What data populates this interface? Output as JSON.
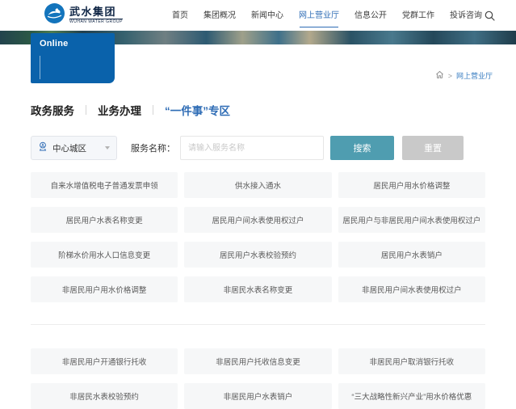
{
  "header": {
    "logo": {
      "name_cn": "武水集团",
      "name_en": "WUHAN WATER GROUP",
      "icon": "water-wave-logo"
    },
    "nav_items": [
      {
        "label": "首页",
        "active": false
      },
      {
        "label": "集团概况",
        "active": false
      },
      {
        "label": "新闻中心",
        "active": false
      },
      {
        "label": "网上营业厅",
        "active": true
      },
      {
        "label": "信息公开",
        "active": false
      },
      {
        "label": "党群工作",
        "active": false
      },
      {
        "label": "投诉咨询",
        "active": false
      }
    ],
    "search_icon": "magnifier"
  },
  "banner": {
    "overlay_label": "Online"
  },
  "breadcrumb": {
    "home_icon": "home",
    "separator": ">",
    "current": "网上营业厅"
  },
  "tabs": [
    {
      "label": "政务服务",
      "active": false
    },
    {
      "label": "业务办理",
      "active": false
    },
    {
      "label": "“一件事”专区",
      "active": true
    }
  ],
  "filter": {
    "district_icon": "location-person",
    "district_value": "中心城区",
    "service_label": "服务名称：",
    "input_placeholder": "请输入服务名称",
    "search_label": "搜索",
    "reset_label": "重置"
  },
  "services": {
    "group1": [
      "自来水增值税电子普通发票申领",
      "供水接入通水",
      "居民用户用水价格调整",
      "居民用户水表名称变更",
      "居民用户间水表使用权过户",
      "居民用户与非居民用户间水表使用权过户",
      "阶梯水价用水人口信息变更",
      "居民用户水表校验预约",
      "居民用户水表销户",
      "非居民用户用水价格调整",
      "非居民水表名称变更",
      "非居民用户间水表使用权过户"
    ],
    "group2": [
      "非居民用户开通银行托收",
      "非居民用户托收信息变更",
      "非居民用户取消银行托收",
      "非居民水表校验预约",
      "非居民用户水表销户",
      "“三大战略性新兴产业”用水价格优惠"
    ]
  },
  "colors": {
    "accent_blue": "#2e6cb5",
    "online_box_blue": "#0a62ab",
    "search_button_teal": "#4f9db0",
    "reset_button_gray": "#c9c9c9",
    "cell_background": "#f6f7f8"
  }
}
